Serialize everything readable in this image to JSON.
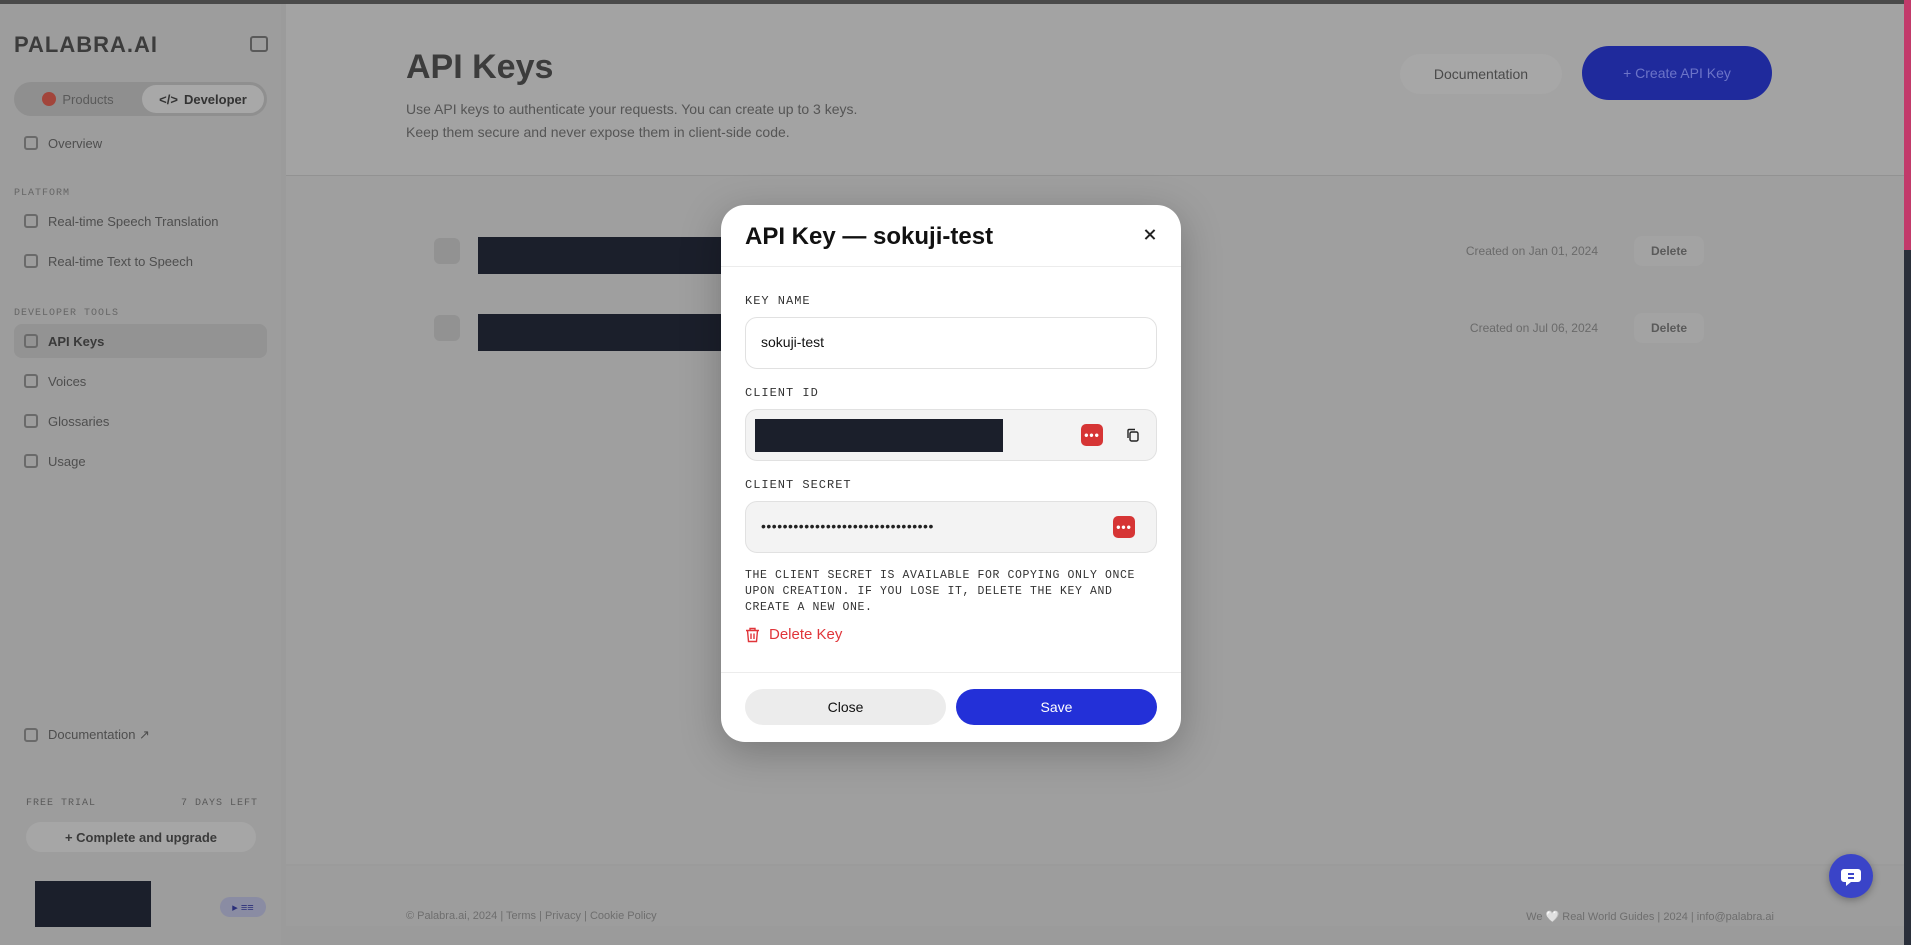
{
  "sidebar": {
    "logo": "PALABRA.AI",
    "mode_products": "Products",
    "mode_developer": "Developer",
    "overview": "Overview",
    "section_platform": "PLATFORM",
    "platform_items": [
      "Real-time Speech Translation",
      "Real-time Text to Speech"
    ],
    "section_tools": "DEVELOPER TOOLS",
    "tool_items": [
      "API Keys",
      "Voices",
      "Glossaries",
      "Usage"
    ],
    "documentation": "Documentation ↗",
    "trial_label": "FREE TRIAL",
    "trial_left": "7 DAYS LEFT",
    "upgrade": "+ Complete and upgrade",
    "user_pill": "▸ ≡≡"
  },
  "main": {
    "title": "API Keys",
    "description": "Use API keys to authenticate your requests. You can create up to 3 keys. Keep them secure and never expose them in client-side code.",
    "documentation_button": "Documentation",
    "create_button": "+ Create API Key",
    "keys": [
      {
        "date": "Created on Jan 01, 2024",
        "delete": "Delete"
      },
      {
        "date": "Created on Jul 06, 2024",
        "delete": "Delete"
      }
    ]
  },
  "footer": {
    "left": "© Palabra.ai, 2024 | Terms | Privacy | Cookie Policy",
    "right": "We 🤍 Real World Guides | 2024 | info@palabra.ai"
  },
  "modal": {
    "title": "API Key — sokuji-test",
    "key_name_label": "KEY NAME",
    "key_name_value": "sokuji-test",
    "client_id_label": "CLIENT ID",
    "client_secret_label": "CLIENT SECRET",
    "client_secret_value": "••••••••••••••••••••••••••••••••",
    "note": "THE CLIENT SECRET IS AVAILABLE FOR COPYING ONLY ONCE UPON CREATION. IF YOU LOSE IT, DELETE THE KEY AND CREATE A NEW ONE.",
    "delete_key": "Delete Key",
    "close_button": "Close",
    "save_button": "Save",
    "password_icon_glyph": "•••"
  },
  "colors": {
    "accent": "#2330d8",
    "danger": "#e0353a"
  }
}
